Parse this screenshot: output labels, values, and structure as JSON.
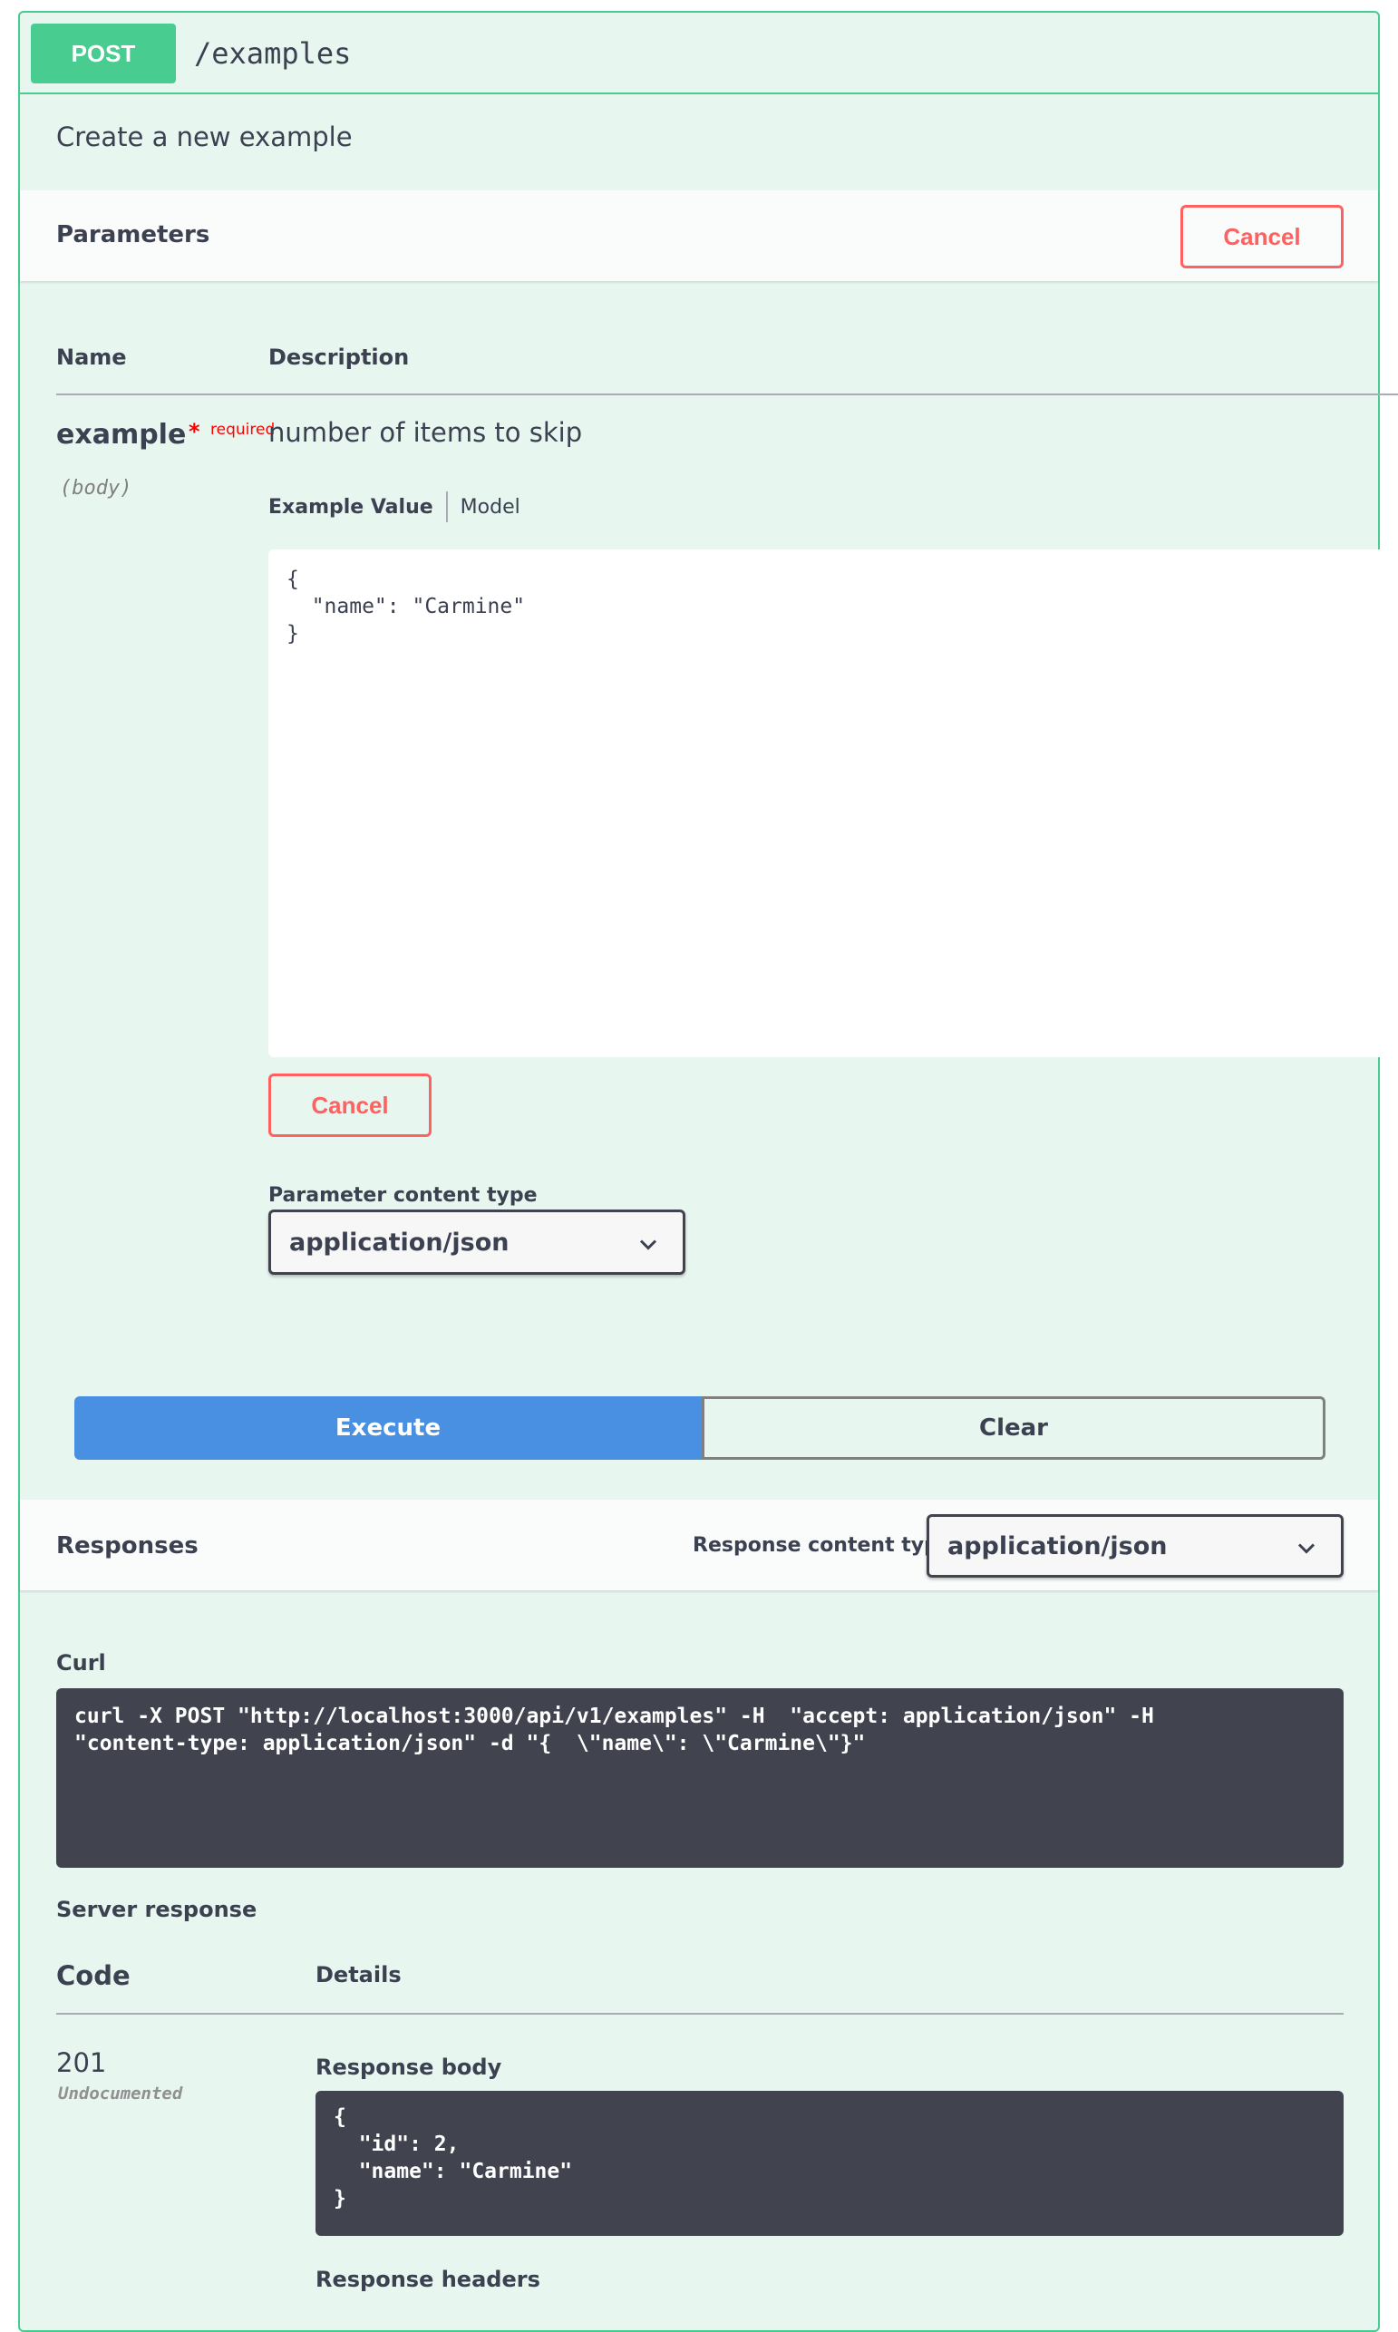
{
  "operation": {
    "method": "POST",
    "path": "/examples",
    "description": "Create a new example"
  },
  "parameters": {
    "title": "Parameters",
    "cancel_label": "Cancel",
    "col_name": "Name",
    "col_description": "Description",
    "param": {
      "name": "example",
      "required_star": "*",
      "required_label": "required",
      "in": "(body)",
      "description": "number of items to skip",
      "tab_example": "Example Value",
      "tab_model": "Model",
      "body_value": "{\n  \"name\": \"Carmine\"\n}",
      "cancel_label": "Cancel",
      "content_type_label": "Parameter content type",
      "content_type_value": "application/json"
    }
  },
  "actions": {
    "execute_label": "Execute",
    "clear_label": "Clear"
  },
  "responses": {
    "title": "Responses",
    "content_type_label": "Response content type",
    "content_type_value": "application/json",
    "curl_label": "Curl",
    "curl_command": "curl -X POST \"http://localhost:3000/api/v1/examples\" -H  \"accept: application/json\" -H\n\"content-type: application/json\" -d \"{  \\\"name\\\": \\\"Carmine\\\"}\"",
    "server_response_label": "Server response",
    "col_code": "Code",
    "col_details": "Details",
    "code": "201",
    "code_note": "Undocumented",
    "response_body_label": "Response body",
    "response_body": "{\n  \"id\": 2,\n  \"name\": \"Carmine\"\n}",
    "response_headers_label": "Response headers"
  },
  "colors": {
    "post_green": "#49cc90",
    "post_bg": "#e8f6f0",
    "cancel_red": "#ff6060",
    "execute_blue": "#4990e2",
    "code_bg": "#41444e"
  },
  "icons": [
    "chevron-down-icon"
  ]
}
